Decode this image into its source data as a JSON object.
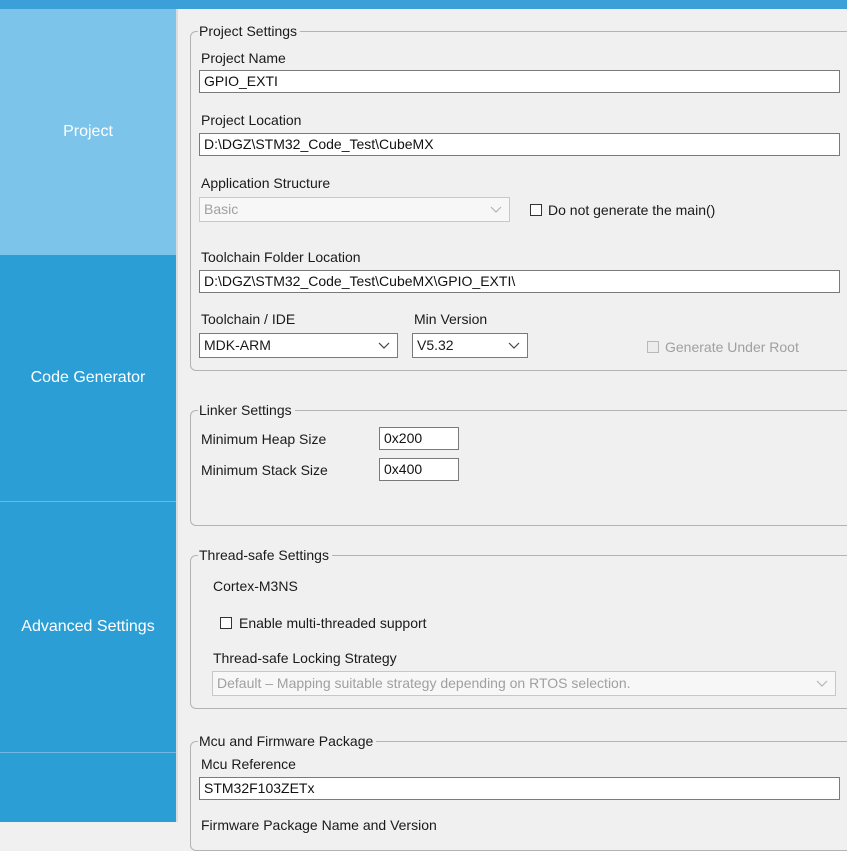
{
  "nav": {
    "items": [
      {
        "label": "Project"
      },
      {
        "label": "Code Generator"
      },
      {
        "label": "Advanced Settings"
      },
      {
        "label": ""
      }
    ]
  },
  "project_settings": {
    "legend": "Project Settings",
    "project_name_label": "Project Name",
    "project_name_value": "GPIO_EXTI",
    "project_location_label": "Project Location",
    "project_location_value": "D:\\DGZ\\STM32_Code_Test\\CubeMX",
    "app_structure_label": "Application Structure",
    "app_structure_value": "Basic",
    "no_main_label": "Do not generate the main()",
    "toolchain_folder_label": "Toolchain Folder Location",
    "toolchain_folder_value": "D:\\DGZ\\STM32_Code_Test\\CubeMX\\GPIO_EXTI\\",
    "toolchain_ide_label": "Toolchain / IDE",
    "toolchain_ide_value": "MDK-ARM",
    "min_version_label": "Min Version",
    "min_version_value": "V5.32",
    "generate_under_root_label": "Generate Under Root"
  },
  "linker_settings": {
    "legend": "Linker Settings",
    "heap_label": "Minimum Heap Size",
    "heap_value": "0x200",
    "stack_label": "Minimum Stack Size",
    "stack_value": "0x400"
  },
  "thread_safe": {
    "legend": "Thread-safe Settings",
    "core": "Cortex-M3NS",
    "enable_label": "Enable multi-threaded support",
    "strategy_label": "Thread-safe Locking Strategy",
    "strategy_value": "Default  –  Mapping suitable strategy depending on RTOS selection."
  },
  "mcu_firmware": {
    "legend": "Mcu and Firmware Package",
    "mcu_ref_label": "Mcu Reference",
    "mcu_ref_value": "STM32F103ZETx",
    "fw_label_partial": "Firmware Package Name and Version"
  }
}
